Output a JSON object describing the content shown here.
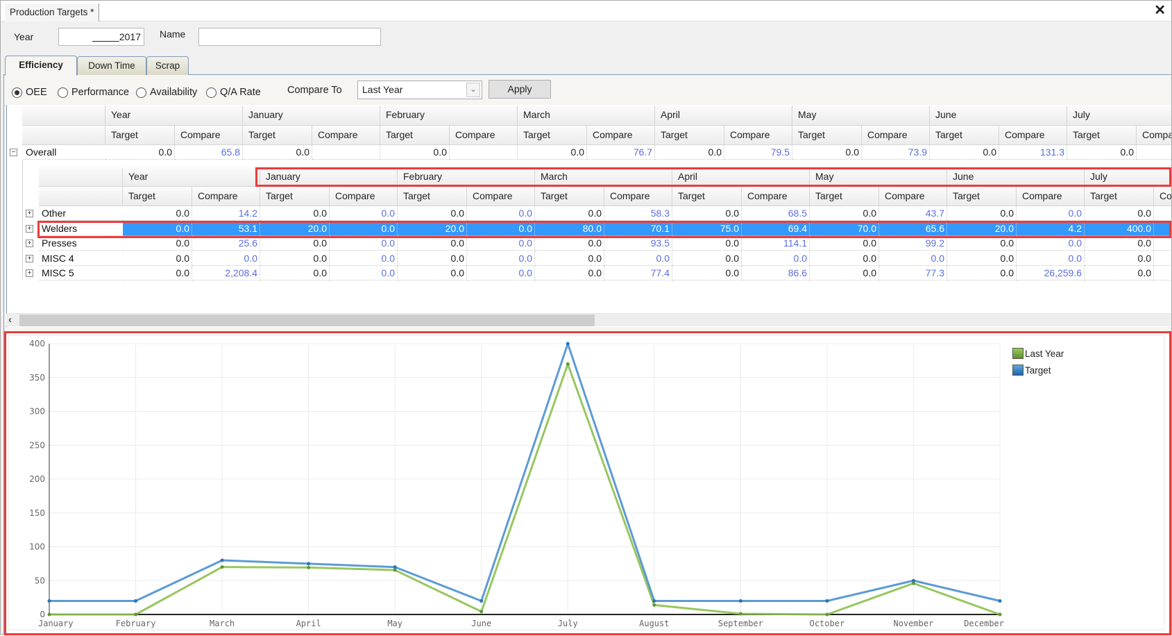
{
  "window": {
    "doc_tab": "Production Targets *",
    "close_label": "✕"
  },
  "filters": {
    "year_label": "Year",
    "year_value": "2017",
    "name_label": "Name",
    "name_value": ""
  },
  "tabs": [
    {
      "label": "Efficiency",
      "active": true
    },
    {
      "label": "Down Time",
      "active": false
    },
    {
      "label": "Scrap",
      "active": false
    }
  ],
  "options": {
    "radios": [
      {
        "label": "OEE",
        "checked": true
      },
      {
        "label": "Performance",
        "checked": false
      },
      {
        "label": "Availability",
        "checked": false
      },
      {
        "label": "Q/A Rate",
        "checked": false
      }
    ],
    "compare_label": "Compare To",
    "compare_value": "Last Year",
    "apply_label": "Apply"
  },
  "grid": {
    "group_headers": [
      "Year",
      "January",
      "February",
      "March",
      "April",
      "May",
      "June",
      "July"
    ],
    "sub_headers": [
      "Target",
      "Compare"
    ],
    "overall": {
      "label": "Overall",
      "values": [
        [
          "0.0",
          "65.8"
        ],
        [
          "0.0",
          ""
        ],
        [
          "0.0",
          ""
        ],
        [
          "0.0",
          "76.7"
        ],
        [
          "0.0",
          "79.5"
        ],
        [
          "0.0",
          "73.9"
        ],
        [
          "0.0",
          "131.3"
        ],
        [
          "0.0",
          ""
        ]
      ]
    },
    "detail_rows": [
      {
        "label": "Other",
        "selected": false,
        "values": [
          [
            "0.0",
            "14.2"
          ],
          [
            "0.0",
            "0.0"
          ],
          [
            "0.0",
            "0.0"
          ],
          [
            "0.0",
            "58.3"
          ],
          [
            "0.0",
            "68.5"
          ],
          [
            "0.0",
            "43.7"
          ],
          [
            "0.0",
            "0.0"
          ],
          [
            "0.0",
            ""
          ]
        ]
      },
      {
        "label": "Welders",
        "selected": true,
        "values": [
          [
            "0.0",
            "53.1"
          ],
          [
            "20.0",
            "0.0"
          ],
          [
            "20.0",
            "0.0"
          ],
          [
            "80.0",
            "70.1"
          ],
          [
            "75.0",
            "69.4"
          ],
          [
            "70.0",
            "65.6"
          ],
          [
            "20.0",
            "4.2"
          ],
          [
            "400.0",
            ""
          ]
        ]
      },
      {
        "label": "Presses",
        "selected": false,
        "values": [
          [
            "0.0",
            "25.6"
          ],
          [
            "0.0",
            "0.0"
          ],
          [
            "0.0",
            "0.0"
          ],
          [
            "0.0",
            "93.5"
          ],
          [
            "0.0",
            "114.1"
          ],
          [
            "0.0",
            "99.2"
          ],
          [
            "0.0",
            "0.0"
          ],
          [
            "0.0",
            ""
          ]
        ]
      },
      {
        "label": "MISC 4",
        "selected": false,
        "values": [
          [
            "0.0",
            "0.0"
          ],
          [
            "0.0",
            "0.0"
          ],
          [
            "0.0",
            "0.0"
          ],
          [
            "0.0",
            "0.0"
          ],
          [
            "0.0",
            "0.0"
          ],
          [
            "0.0",
            "0.0"
          ],
          [
            "0.0",
            "0.0"
          ],
          [
            "0.0",
            ""
          ]
        ]
      },
      {
        "label": "MISC 5",
        "selected": false,
        "values": [
          [
            "0.0",
            "2,208.4"
          ],
          [
            "0.0",
            "0.0"
          ],
          [
            "0.0",
            "0.0"
          ],
          [
            "0.0",
            "77.4"
          ],
          [
            "0.0",
            "86.6"
          ],
          [
            "0.0",
            "77.3"
          ],
          [
            "0.0",
            "26,259.6"
          ],
          [
            "0.0",
            ""
          ]
        ]
      }
    ],
    "expand_icon": "+",
    "collapse_icon": "−",
    "scroll_left_icon": "‹"
  },
  "colors": {
    "last_year": "#8dc04f",
    "target": "#4a90d0",
    "selection": "#3399ff",
    "highlight_box": "#ec3b3b",
    "compare_text": "#5a6ee0"
  },
  "chart_data": {
    "type": "line",
    "title": "",
    "xlabel": "",
    "ylabel": "",
    "categories": [
      "January",
      "February",
      "March",
      "April",
      "May",
      "June",
      "July",
      "August",
      "September",
      "October",
      "November",
      "December"
    ],
    "ylim": [
      0,
      400
    ],
    "yticks": [
      0,
      50,
      100,
      150,
      200,
      250,
      300,
      350,
      400
    ],
    "grid": true,
    "legend_position": "top-right",
    "series": [
      {
        "name": "Last Year",
        "color": "#8dc04f",
        "values": [
          0,
          0,
          70.1,
          69.4,
          65.6,
          4.2,
          370,
          14,
          1,
          0,
          46,
          0
        ]
      },
      {
        "name": "Target",
        "color": "#4a90d0",
        "values": [
          20,
          20,
          80,
          75,
          70,
          20,
          400,
          20,
          20,
          20,
          50,
          20
        ]
      }
    ]
  }
}
